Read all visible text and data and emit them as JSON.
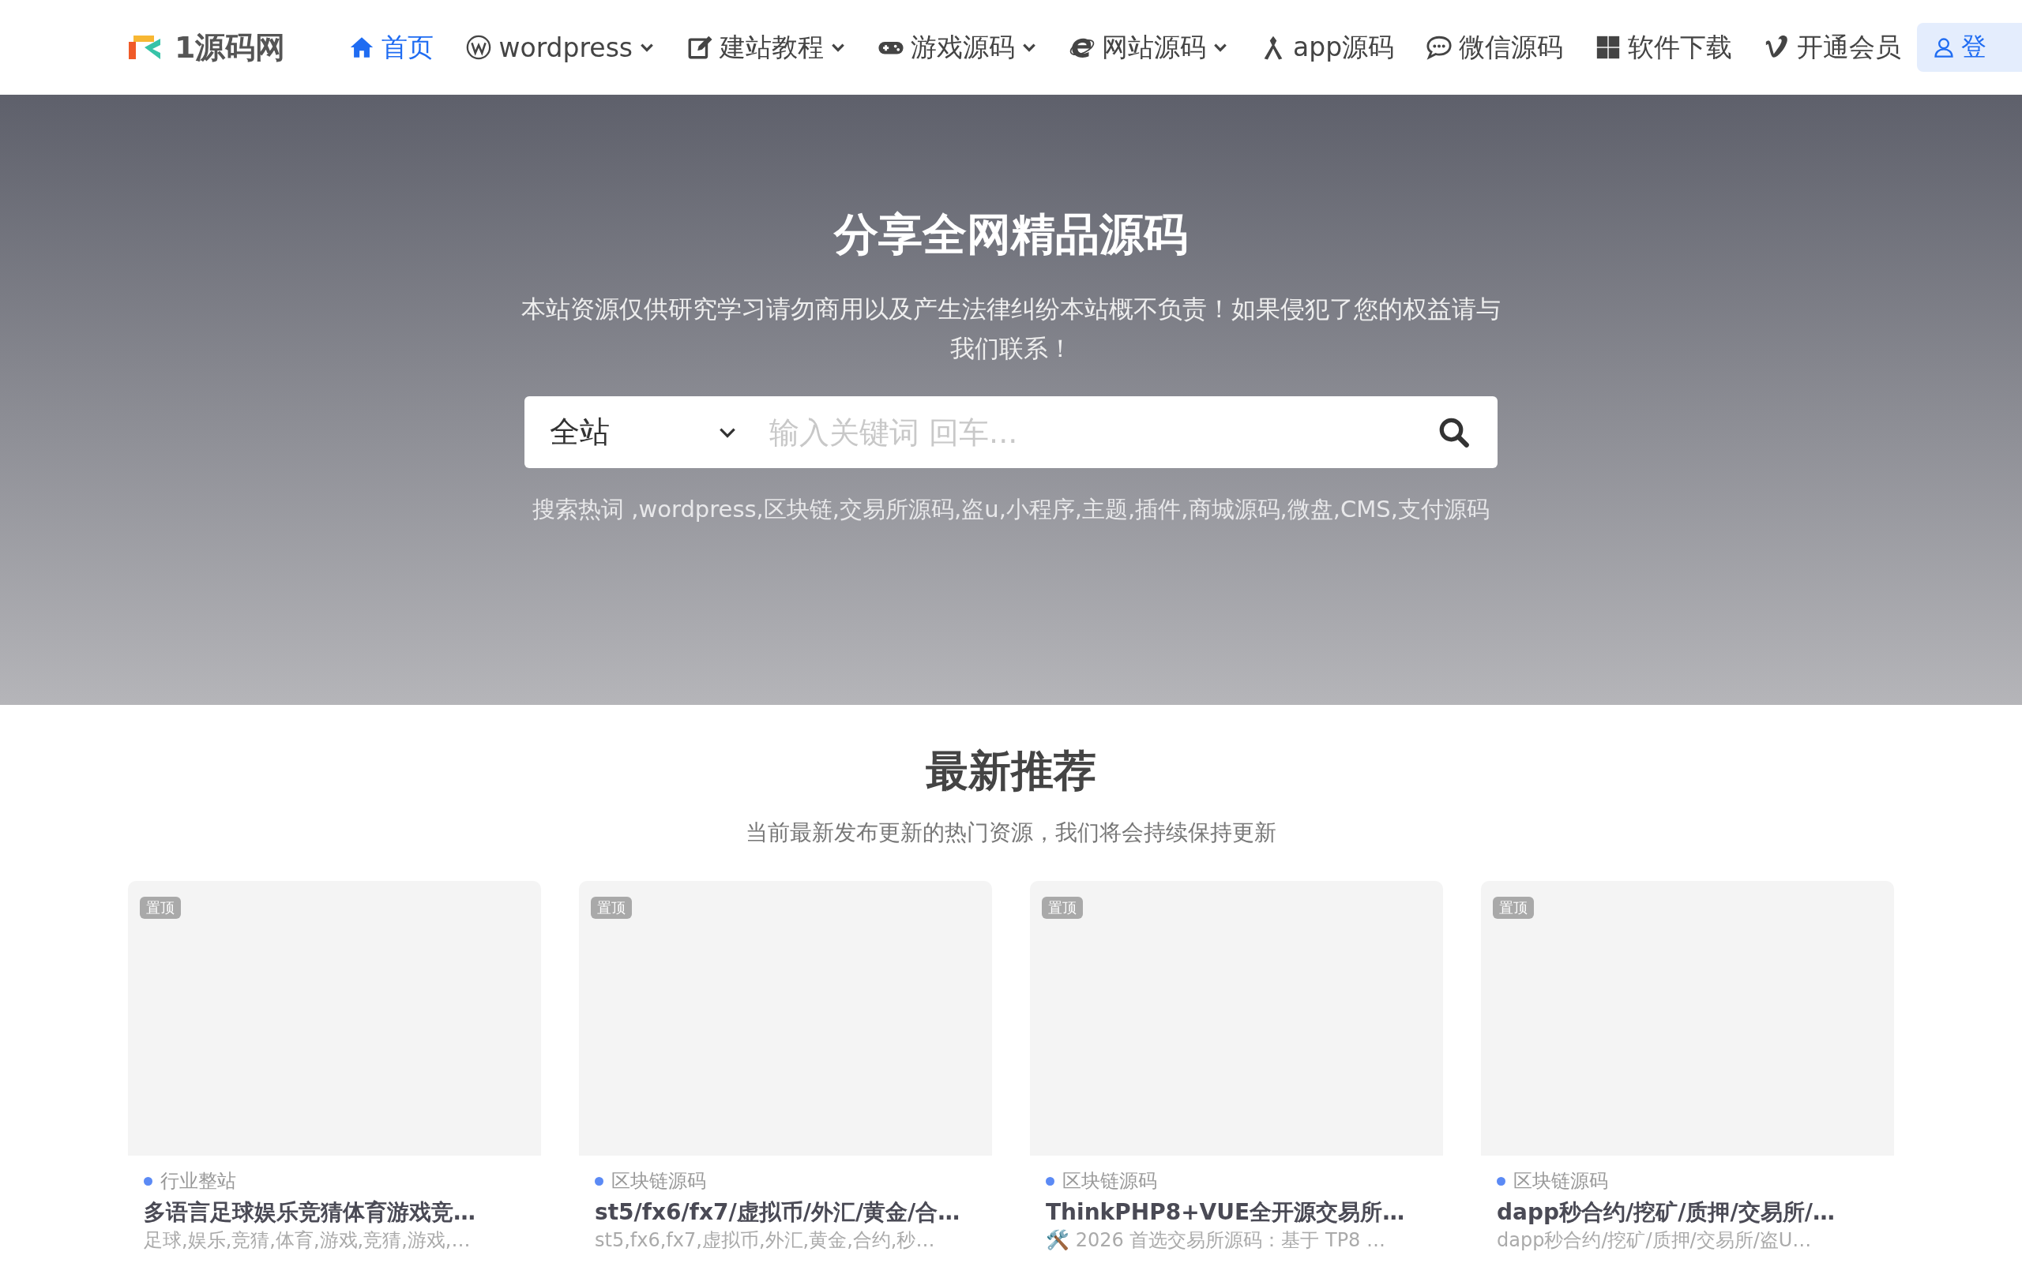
{
  "header": {
    "logo_text": "1源码网",
    "nav": [
      {
        "label": "首页",
        "selected": true,
        "dropdown": false
      },
      {
        "label": "wordpress",
        "selected": false,
        "dropdown": true
      },
      {
        "label": "建站教程",
        "selected": false,
        "dropdown": true
      },
      {
        "label": "游戏源码",
        "selected": false,
        "dropdown": true
      },
      {
        "label": "网站源码",
        "selected": false,
        "dropdown": true
      },
      {
        "label": "app源码",
        "selected": false,
        "dropdown": false
      },
      {
        "label": "微信源码",
        "selected": false,
        "dropdown": false
      },
      {
        "label": "软件下载",
        "selected": false,
        "dropdown": false
      },
      {
        "label": "开通会员",
        "selected": false,
        "dropdown": false
      }
    ],
    "login_button": "登"
  },
  "hero": {
    "title": "分享全网精品源码",
    "subtitle": "本站资源仅供研究学习请勿商用以及产生法律纠纷本站概不负责！如果侵犯了您的权益请与我们联系！",
    "search": {
      "scope": "全站",
      "placeholder": "输入关键词 回车..."
    },
    "hot_words": "搜索热词  ,wordpress,区块链,交易所源码,盗u,小程序,主题,插件,商城源码,微盘,CMS,支付源码"
  },
  "section": {
    "title": "最新推荐",
    "subtitle": "当前最新发布更新的热门资源，我们将会持续保持更新",
    "cards": [
      {
        "badge": "置顶",
        "category": "行业整站",
        "title": "多语言足球娱乐竞猜体育游戏竞…",
        "description": "足球,娱乐,竞猜,体育,游戏,竞猜,游戏,…"
      },
      {
        "badge": "置顶",
        "category": "区块链源码",
        "title": "st5/fx6/fx7/虚拟币/外汇/黄金/合…",
        "description": "st5,fx6,fx7,虚拟币,外汇,黄金,合约,秒…"
      },
      {
        "badge": "置顶",
        "category": "区块链源码",
        "title": "ThinkPHP8+VUE全开源交易所…",
        "description": "🛠️ 2026 首选交易所源码：基于 TP8 …"
      },
      {
        "badge": "置顶",
        "category": "区块链源码",
        "title": "dapp秒合约/挖矿/质押/交易所/…",
        "description": "dapp秒合约/挖矿/质押/交易所/盗U…"
      }
    ]
  }
}
